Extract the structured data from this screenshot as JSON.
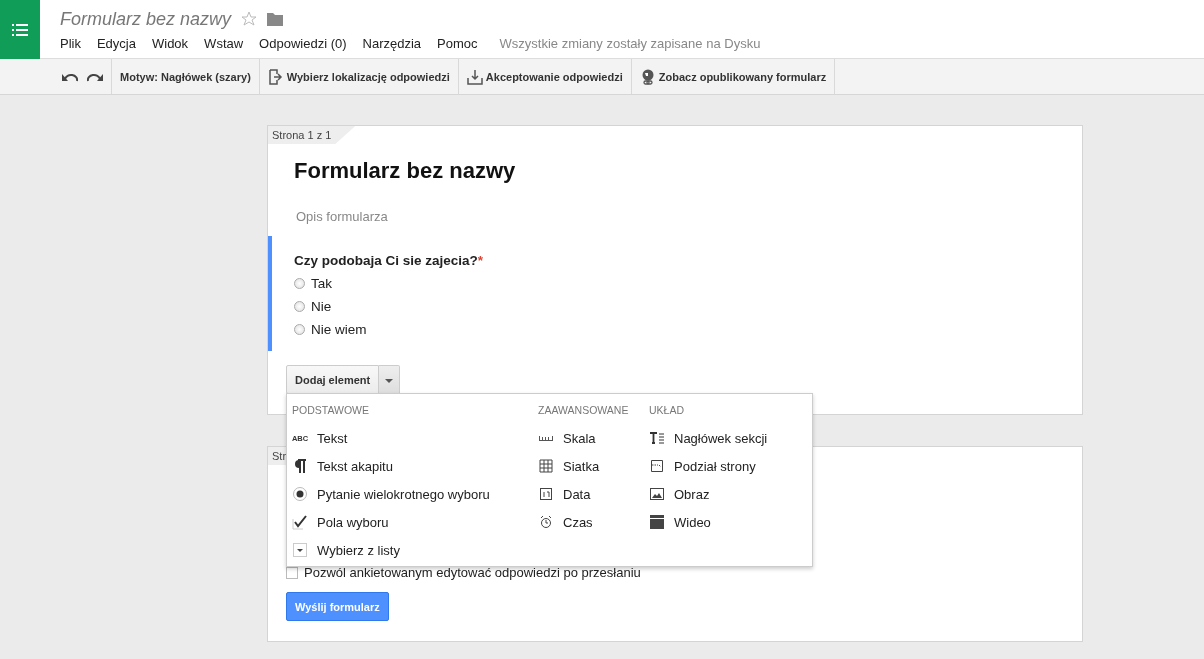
{
  "app": {
    "title": "Formularz bez nazwy",
    "starred": false,
    "menus": [
      "Plik",
      "Edycja",
      "Widok",
      "Wstaw",
      "Odpowiedzi (0)",
      "Narzędzia",
      "Pomoc"
    ],
    "save_status": "Wszystkie zmiany zostały zapisane na Dysku"
  },
  "toolbar": {
    "items": [
      {
        "kind": "theme",
        "label": "Motyw: Nagłówek (szary)"
      },
      {
        "kind": "destination",
        "label": "Wybierz lokalizację odpowiedzi"
      },
      {
        "kind": "accept",
        "label": "Akceptowanie odpowiedzi"
      },
      {
        "kind": "published",
        "label": "Zobacz opublikowany formularz"
      }
    ]
  },
  "form": {
    "page_label": "Strona 1 z 1",
    "title": "Formularz bez nazwy",
    "description": "Opis formularza",
    "question": {
      "text": "Czy podobaja Ci sie zajecia?",
      "required_mark": "*",
      "options": [
        {
          "label": "Tak",
          "selected": false
        },
        {
          "label": "Nie",
          "selected": false
        },
        {
          "label": "Nie wiem",
          "selected": false
        }
      ]
    },
    "add_button": "Dodaj element",
    "add_menu": [
      {
        "heading": "PODSTAWOWE",
        "items": [
          {
            "kind": "text",
            "icon_text": "ABC",
            "label": "Tekst"
          },
          {
            "kind": "paragraph",
            "label": "Tekst akapitu"
          },
          {
            "kind": "radio",
            "label": "Pytanie wielokrotnego wyboru"
          },
          {
            "kind": "check",
            "label": "Pola wyboru"
          },
          {
            "kind": "list",
            "label": "Wybierz z listy"
          }
        ]
      },
      {
        "heading": "ZAAWANSOWANE",
        "items": [
          {
            "kind": "scale",
            "label": "Skala"
          },
          {
            "kind": "grid",
            "label": "Siatka"
          },
          {
            "kind": "date",
            "label": "Data"
          },
          {
            "kind": "time",
            "label": "Czas"
          }
        ]
      },
      {
        "heading": "UKŁAD",
        "items": [
          {
            "kind": "header",
            "label": "Nagłówek sekcji"
          },
          {
            "kind": "pagebreak",
            "label": "Podział strony"
          },
          {
            "kind": "image",
            "label": "Obraz"
          },
          {
            "kind": "video",
            "label": "Wideo"
          }
        ]
      }
    ]
  },
  "confirmation_page": {
    "page_label": "Str",
    "edit_option": {
      "label": "Pozwól ankietowanym edytować odpowiedzi po przesłaniu",
      "checked": false
    },
    "submit_button": "Wyślij formularz"
  }
}
